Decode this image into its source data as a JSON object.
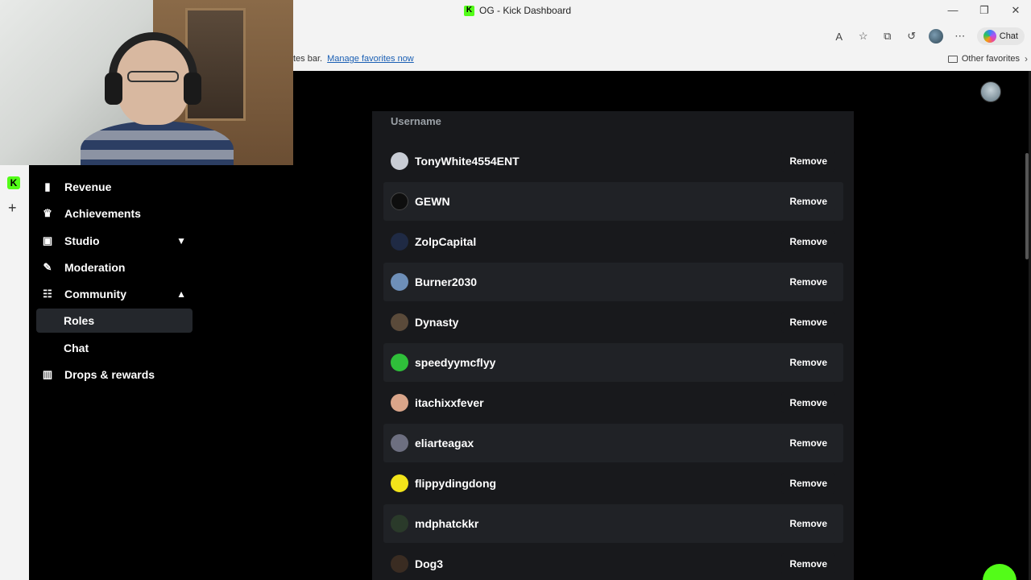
{
  "browser": {
    "tab_title": "OG - Kick Dashboard",
    "favicon_letter": "K",
    "favbar_text": "tes bar.",
    "favbar_link": "Manage favorites now",
    "other_favorites": "Other favorites",
    "chat_label": "Chat"
  },
  "rail": {
    "logo_letter": "K",
    "add_symbol": "+"
  },
  "sidebar": {
    "items": [
      {
        "label": "Revenue",
        "icon": "chart-icon"
      },
      {
        "label": "Achievements",
        "icon": "trophy-icon"
      },
      {
        "label": "Studio",
        "icon": "studio-icon"
      },
      {
        "label": "Moderation",
        "icon": "wrench-icon"
      },
      {
        "label": "Community",
        "icon": "people-icon"
      },
      {
        "label": "Roles",
        "icon": ""
      },
      {
        "label": "Chat",
        "icon": ""
      },
      {
        "label": "Drops & rewards",
        "icon": "gift-icon"
      }
    ],
    "active": "Roles"
  },
  "roles": {
    "column_header": "Username",
    "remove_label": "Remove",
    "users": [
      {
        "name": "TonyWhite4554ENT",
        "avatar_color": "#c8ccd4"
      },
      {
        "name": "GEWN",
        "avatar_color": "#0e0e0e"
      },
      {
        "name": "ZolpCapital",
        "avatar_color": "#1f2a44"
      },
      {
        "name": "Burner2030",
        "avatar_color": "#6e8fb8"
      },
      {
        "name": "Dynasty",
        "avatar_color": "#5a4a3a"
      },
      {
        "name": "speedyymcflyy",
        "avatar_color": "#2fbf3a"
      },
      {
        "name": "itachixxfever",
        "avatar_color": "#d9a58a"
      },
      {
        "name": "eliarteagax",
        "avatar_color": "#6d6f80"
      },
      {
        "name": "flippydingdong",
        "avatar_color": "#f2e41a"
      },
      {
        "name": "mdphatckkr",
        "avatar_color": "#2a3a2a"
      },
      {
        "name": "Dog3",
        "avatar_color": "#3a2c22"
      }
    ]
  },
  "colors": {
    "brand": "#53fc18",
    "card_bg": "#18191c",
    "row_alt_bg": "#202226",
    "active_nav": "#24272c"
  }
}
